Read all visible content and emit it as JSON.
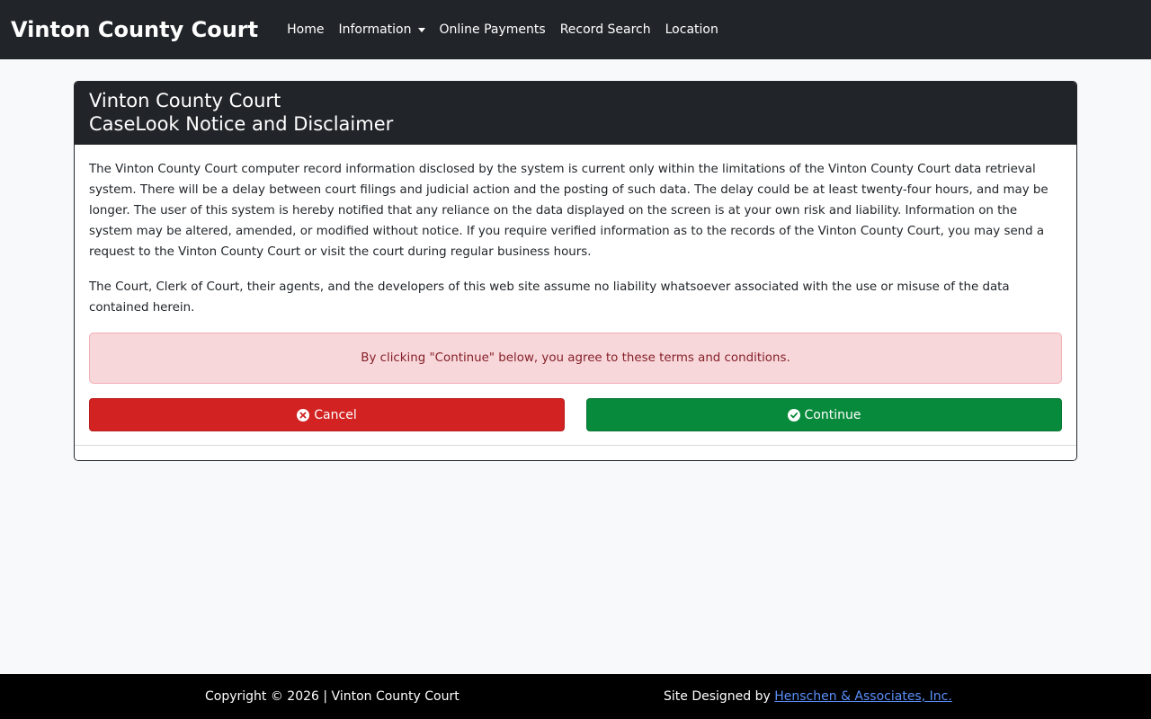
{
  "navbar": {
    "brand": "Vinton County Court",
    "links": [
      {
        "label": "Home"
      },
      {
        "label": "Information"
      },
      {
        "label": "Online Payments"
      },
      {
        "label": "Record Search"
      },
      {
        "label": "Location"
      }
    ]
  },
  "card": {
    "title_line1": "Vinton County Court",
    "title_line2": "CaseLook Notice and Disclaimer",
    "paragraph1": "The Vinton County Court computer record information disclosed by the system is current only within the limitations of the Vinton County Court data retrieval system. There will be a delay between court filings and judicial action and the posting of such data. The delay could be at least twenty-four hours, and may be longer. The user of this system is hereby notified that any reliance on the data displayed on the screen is at your own risk and liability. Information on the system may be altered, amended, or modified without notice. If you require verified information as to the records of the Vinton County Court, you may send a request to the Vinton County Court or visit the court during regular business hours.",
    "paragraph2": "The Court, Clerk of Court, their agents, and the developers of this web site assume no liability whatsoever associated with the use or misuse of the data contained herein.",
    "alert": "By clicking \"Continue\" below, you agree to these terms and conditions.",
    "cancel_label": "Cancel",
    "continue_label": "Continue"
  },
  "footer": {
    "copyright": "Copyright © 2026 | Vinton County Court",
    "designed_by": "Site Designed by",
    "designer": "Henschen & Associates, Inc."
  },
  "colors": {
    "navbar": "#212529",
    "cancel": "#d22222",
    "continue": "#078a3b",
    "alert_bg": "#f8d7da",
    "alert_text": "#842029",
    "link": "#5b8ff9"
  },
  "icons": {
    "cancel": "times-circle-icon",
    "continue": "check-circle-icon"
  }
}
